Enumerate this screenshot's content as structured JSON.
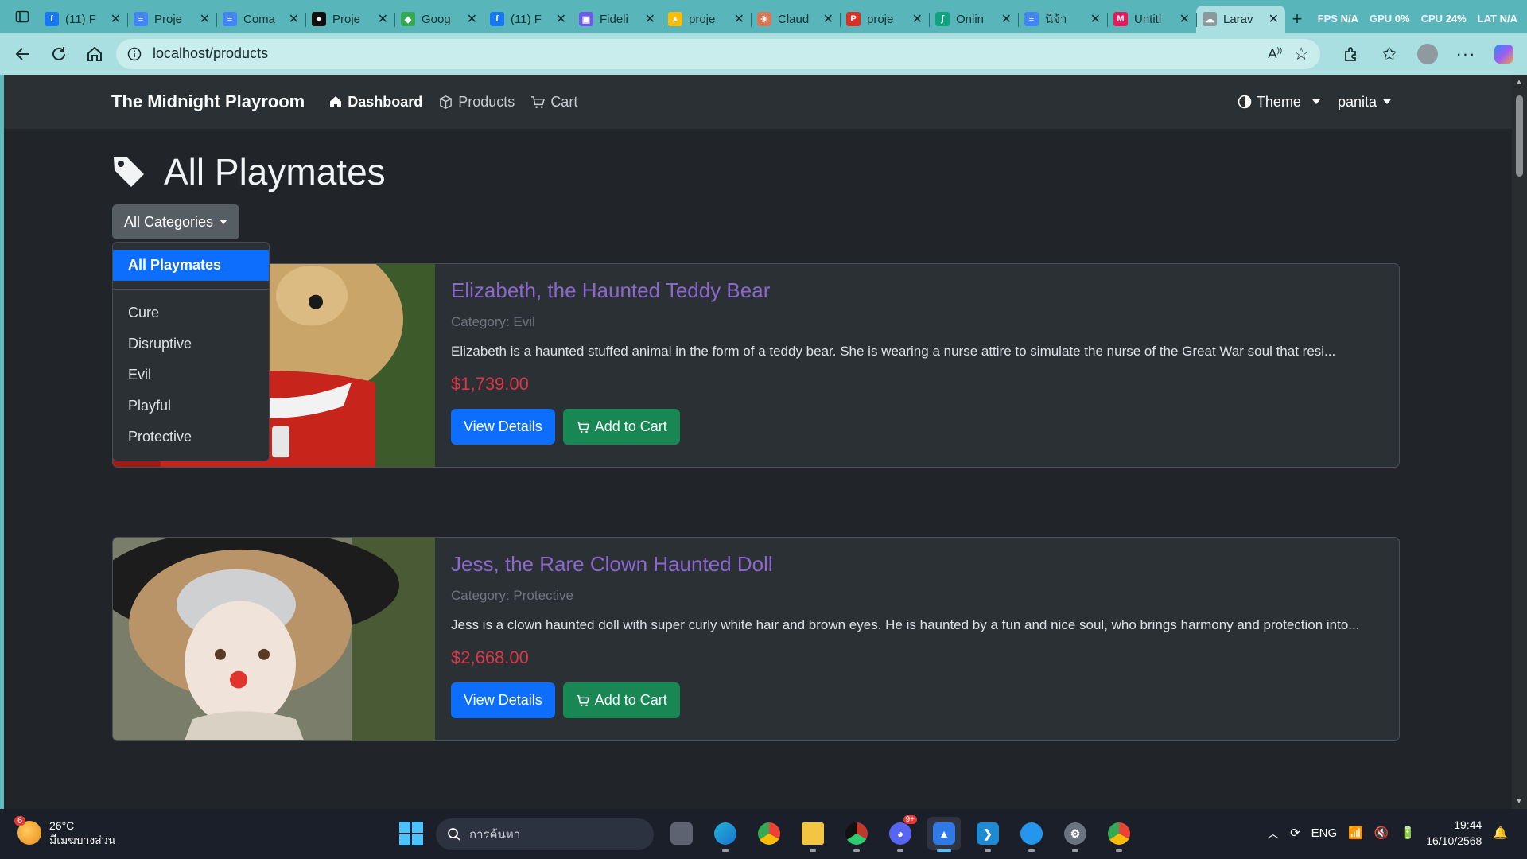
{
  "browser": {
    "tabs": [
      {
        "title": "(11) F",
        "color": "#1877f2",
        "glyph": "f"
      },
      {
        "title": "Proje",
        "color": "#4285f4",
        "glyph": "≡"
      },
      {
        "title": "Coma",
        "color": "#4285f4",
        "glyph": "≡"
      },
      {
        "title": "Proje",
        "color": "#111111",
        "glyph": "●"
      },
      {
        "title": "Goog",
        "color": "#34a853",
        "glyph": "◆"
      },
      {
        "title": "(11) F",
        "color": "#1877f2",
        "glyph": "f"
      },
      {
        "title": "Fideli",
        "color": "#6c5ce7",
        "glyph": "▣"
      },
      {
        "title": "proje",
        "color": "#fbbc04",
        "glyph": "▲"
      },
      {
        "title": "Claud",
        "color": "#d97757",
        "glyph": "✳"
      },
      {
        "title": "proje",
        "color": "#d93025",
        "glyph": "P"
      },
      {
        "title": "Onlin",
        "color": "#10a37f",
        "glyph": "∫"
      },
      {
        "title": "นี่จ้า",
        "color": "#4285f4",
        "glyph": "≡"
      },
      {
        "title": "Untitl",
        "color": "#e6195b",
        "glyph": "M"
      },
      {
        "title": "Larav",
        "color": "#8a9a9b",
        "glyph": "☁"
      }
    ],
    "perf": {
      "fps_label": "FPS",
      "fps": "N/A",
      "gpu_label": "GPU",
      "gpu": "0%",
      "cpu_label": "CPU",
      "cpu": "24%",
      "lat_label": "LAT",
      "lat": "N/A"
    },
    "url": "localhost/products"
  },
  "nav": {
    "brand": "The Midnight Playroom",
    "links": [
      {
        "label": "Dashboard",
        "icon": "home-icon"
      },
      {
        "label": "Products",
        "icon": "box-icon"
      },
      {
        "label": "Cart",
        "icon": "cart-icon"
      }
    ],
    "theme": "Theme",
    "user": "panita"
  },
  "page": {
    "title": "All Playmates",
    "category_button": "All Categories",
    "dropdown": {
      "all": "All Playmates",
      "items": [
        "Cure",
        "Disruptive",
        "Evil",
        "Playful",
        "Protective"
      ]
    },
    "products": [
      {
        "name": "Elizabeth, the Haunted Teddy Bear",
        "category": "Category: Evil",
        "description": "Elizabeth is a haunted stuffed animal in the form of a teddy bear. She is wearing a nurse attire to simulate the nurse of the Great War soul that resi...",
        "price": "$1,739.00",
        "view": "View Details",
        "add": "Add to Cart"
      },
      {
        "name": "Jess, the Rare Clown Haunted Doll",
        "category": "Category: Protective",
        "description": "Jess is a clown haunted doll with super curly white hair and brown eyes. He is haunted by a fun and nice soul, who brings harmony and protection into...",
        "price": "$2,668.00",
        "view": "View Details",
        "add": "Add to Cart"
      }
    ]
  },
  "taskbar": {
    "weather_temp": "26°C",
    "weather_desc": "มีเมฆบางส่วน",
    "weather_badge": "6",
    "search_placeholder": "การค้นหา",
    "discord_badge": "9+",
    "lang": "ENG",
    "time": "19:44",
    "date": "16/10/2568"
  }
}
